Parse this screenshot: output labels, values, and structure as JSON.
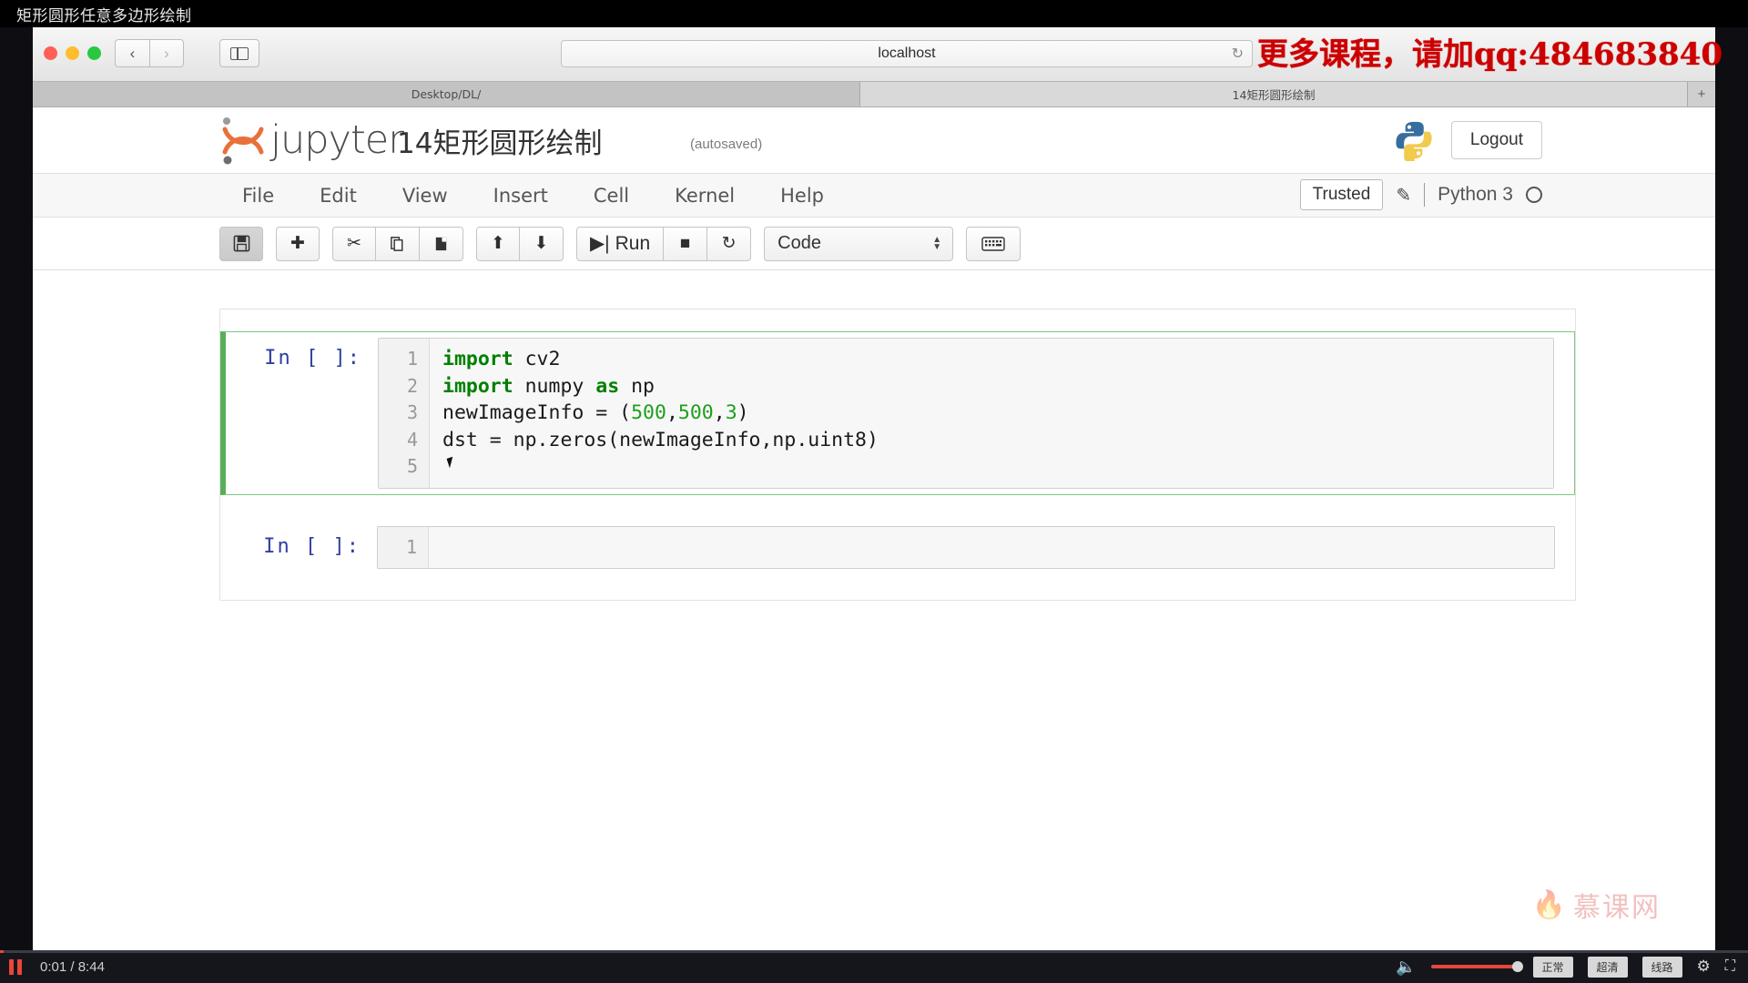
{
  "video": {
    "course_title": "矩形圆形任意多边形绘制",
    "current_time": "0:01",
    "total_time": "8:44",
    "pause_label": "pause",
    "quality_buttons": [
      "正常",
      "超清",
      "线路"
    ],
    "progress_percent": 0.2,
    "volume_percent": 100
  },
  "overlay": {
    "ad_text": "更多课程，请加qq:484683840",
    "ad_color": "#cc0000",
    "watermark_text": "慕课网",
    "watermark_flame": "flame-icon"
  },
  "browser": {
    "url": "localhost",
    "back_glyph": "‹",
    "forward_glyph": "›",
    "reload_glyph": "↻",
    "sidebar_icon": "sidebar-icon",
    "tabs": [
      {
        "label": "Desktop/DL/",
        "active": false
      },
      {
        "label": "14矩形圆形绘制",
        "active": true
      }
    ],
    "new_tab_glyph": "+"
  },
  "jupyter": {
    "logo_word": "jupyter",
    "notebook_name": "14矩形圆形绘制",
    "autosaved_label": "(autosaved)",
    "logout_label": "Logout",
    "python_logo": "python-logo",
    "menu": [
      "File",
      "Edit",
      "View",
      "Insert",
      "Cell",
      "Kernel",
      "Help"
    ],
    "trusted_label": "Trusted",
    "pencil_icon": "pencil-icon",
    "kernel_label": "Python 3",
    "kernel_status": "idle-circle",
    "toolbar": {
      "save_icon": "save-icon",
      "add_icon": "plus-icon",
      "cut_icon": "scissors-icon",
      "copy_icon": "copy-icon",
      "paste_icon": "paste-icon",
      "move_up_icon": "arrow-up-icon",
      "move_down_icon": "arrow-down-icon",
      "run_label": "Run",
      "run_icon": "run-icon",
      "stop_icon": "stop-square-icon",
      "restart_icon": "restart-icon",
      "cell_type": "Code",
      "keyboard_icon": "keyboard-icon"
    },
    "cells": [
      {
        "prompt": "In [ ]:",
        "selected": true,
        "line_numbers": [
          "1",
          "2",
          "3",
          "4",
          "5"
        ],
        "lines": [
          [
            {
              "t": "import",
              "c": "kw"
            },
            {
              "t": " cv2",
              "c": ""
            }
          ],
          [
            {
              "t": "import",
              "c": "kw"
            },
            {
              "t": " numpy ",
              "c": ""
            },
            {
              "t": "as",
              "c": "kw"
            },
            {
              "t": " np",
              "c": ""
            }
          ],
          [
            {
              "t": "newImageInfo = (",
              "c": ""
            },
            {
              "t": "500",
              "c": "num"
            },
            {
              "t": ",",
              "c": ""
            },
            {
              "t": "500",
              "c": "num"
            },
            {
              "t": ",",
              "c": ""
            },
            {
              "t": "3",
              "c": "num"
            },
            {
              "t": ")",
              "c": ""
            }
          ],
          [
            {
              "t": "dst = np.zeros(newImageInfo,np.uint8)",
              "c": ""
            }
          ],
          [
            {
              "t": "",
              "c": ""
            }
          ]
        ]
      },
      {
        "prompt": "In [ ]:",
        "selected": false,
        "line_numbers": [
          "1"
        ],
        "lines": [
          [
            {
              "t": "",
              "c": ""
            }
          ]
        ]
      }
    ]
  }
}
